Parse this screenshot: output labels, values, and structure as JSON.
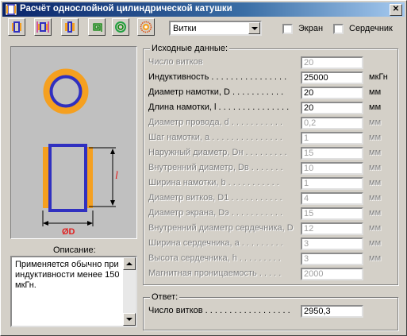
{
  "window": {
    "title": "Расчёт однослойной цилиндрической катушки",
    "close_label": "✕"
  },
  "toolbar": {
    "buttons": [
      {
        "icon": "single-layer-coil-icon"
      },
      {
        "icon": "shielded-coil-icon"
      },
      {
        "icon": "multi-layer-coil-icon"
      },
      {
        "icon": "flat-spiral-coil-icon"
      },
      {
        "icon": "toroid-coil-icon"
      },
      {
        "icon": "flat-pcb-coil-icon"
      }
    ],
    "mode_select_value": "Витки",
    "screen_checkbox_label": "Экран",
    "core_checkbox_label": "Сердечник"
  },
  "picture": {
    "length_symbol": "l",
    "diameter_symbol": "ØD",
    "colors": {
      "winding": "#f5a020",
      "former": "#3030c0"
    }
  },
  "description": {
    "label": "Описание:",
    "text": "Применяется обычно при индуктивности менее 150 мкГн."
  },
  "inputs": {
    "legend": "Исходные данные:",
    "rows": [
      {
        "label": "Число витков",
        "value": "20",
        "unit": "",
        "enabled": false
      },
      {
        "label": "Индуктивность . . . . . . . . . . . . . . . .",
        "value": "25000",
        "unit": "мкГн",
        "enabled": true
      },
      {
        "label": "Диаметр намотки, D . . . . . . . . . . .",
        "value": "20",
        "unit": "мм",
        "enabled": true
      },
      {
        "label": "Длина намотки, l . . . . . . . . . . . . . . .",
        "value": "20",
        "unit": "мм",
        "enabled": true
      },
      {
        "label": "Диаметр провода, d . . . . . . . . . . .",
        "value": "0,2",
        "unit": "мм",
        "enabled": false
      },
      {
        "label": "Шаг намотки, a . . . . . . . . . . . . . . .",
        "value": "1",
        "unit": "мм",
        "enabled": false
      },
      {
        "label": "Наружный диаметр, Dн . . . . . . . . .",
        "value": "15",
        "unit": "мм",
        "enabled": false
      },
      {
        "label": "Внутренний диаметр, Dв . . . . . . .",
        "value": "10",
        "unit": "мм",
        "enabled": false
      },
      {
        "label": "Ширина намотки, b . . . . . . . . . . .",
        "value": "1",
        "unit": "мм",
        "enabled": false
      },
      {
        "label": "Диаметр витков, D1 . . . . . . . . . . .",
        "value": "4",
        "unit": "мм",
        "enabled": false
      },
      {
        "label": "Диаметр экрана, Dэ . . . . . . . . . . .",
        "value": "15",
        "unit": "мм",
        "enabled": false
      },
      {
        "label": "Внутренний диаметр сердечника, D",
        "value": "12",
        "unit": "мм",
        "enabled": false
      },
      {
        "label": "Ширина сердечника, a . . . . . . . . .",
        "value": "3",
        "unit": "мм",
        "enabled": false
      },
      {
        "label": "Высота сердечника, h . . . . . . . . .",
        "value": "3",
        "unit": "мм",
        "enabled": false
      },
      {
        "label": "Магнитная проницаемость . . . . .",
        "value": "2000",
        "unit": "",
        "enabled": false
      }
    ]
  },
  "answer": {
    "legend": "Ответ:",
    "label": "Число витков . . . . . . . . . . . . . . . . . .",
    "value": "2950,3"
  }
}
